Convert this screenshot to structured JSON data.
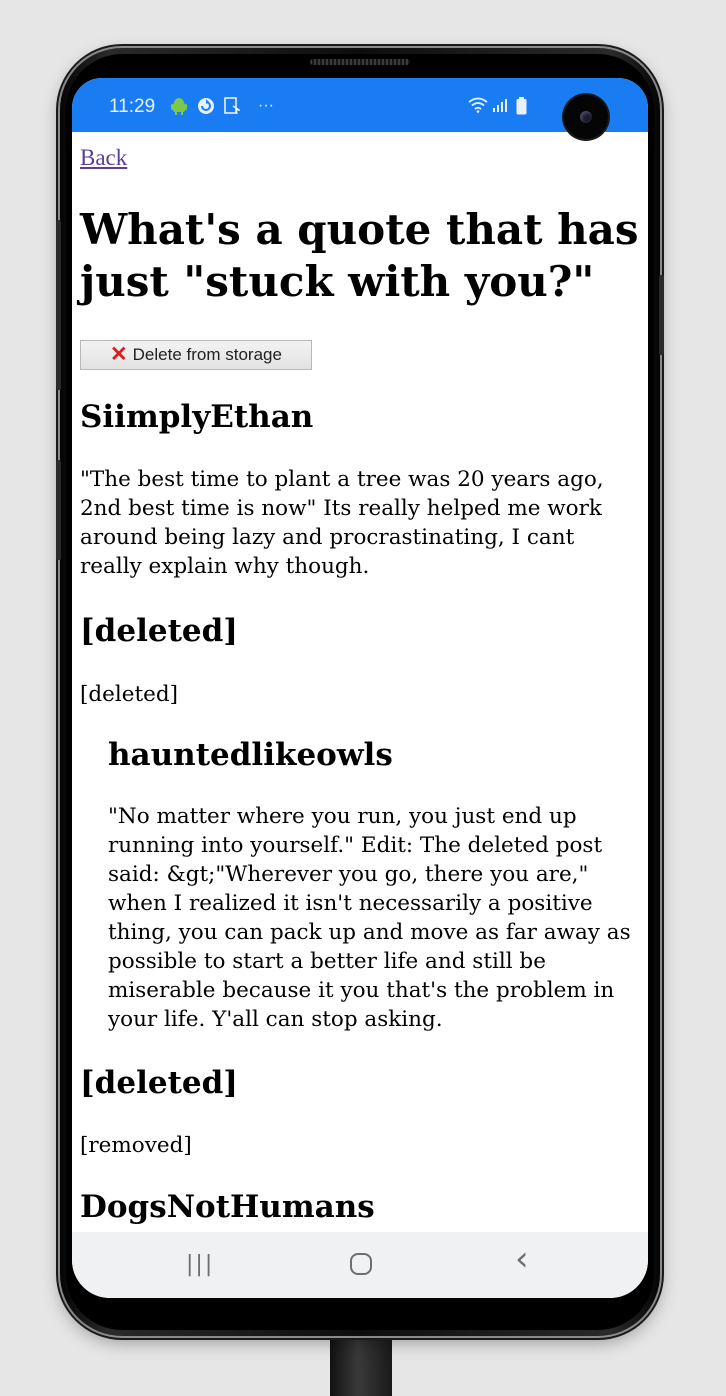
{
  "status_bar": {
    "time": "11:29",
    "icons": [
      "android-icon",
      "sync-icon",
      "screenshot-icon",
      "more-icon",
      "wifi-icon",
      "signal-icon",
      "battery-icon"
    ],
    "more_glyph": "···",
    "background_color": "#1a7cf2"
  },
  "page": {
    "back_label": "Back",
    "title": "What's a quote that has just \"stuck with you?\"",
    "delete_label": "Delete from storage"
  },
  "comments": [
    {
      "author": "SiimplyEthan",
      "body": "\"The best time to plant a tree was 20 years ago, 2nd best time is now\" Its really helped me work around being lazy and procrastinating, I cant really explain why though."
    },
    {
      "author": "[deleted]",
      "body": "[deleted]"
    },
    {
      "author": "hauntedlikeowls",
      "body": "\"No matter where you run, you just end up running into yourself.\" Edit: The deleted post said: &gt;\"Wherever you go, there you are,\" when I realized it isn't necessarily a positive thing, you can pack up and move as far away as possible to start a better life and still be miserable because it you that's the problem in your life. Y'all can stop asking."
    },
    {
      "author": "[deleted]",
      "body": "[removed]"
    },
    {
      "author": "DogsNotHumans",
      "body": ""
    }
  ],
  "nav_bar": {
    "recents_glyph": "|||",
    "home_glyph": "○",
    "back_glyph": "‹"
  }
}
